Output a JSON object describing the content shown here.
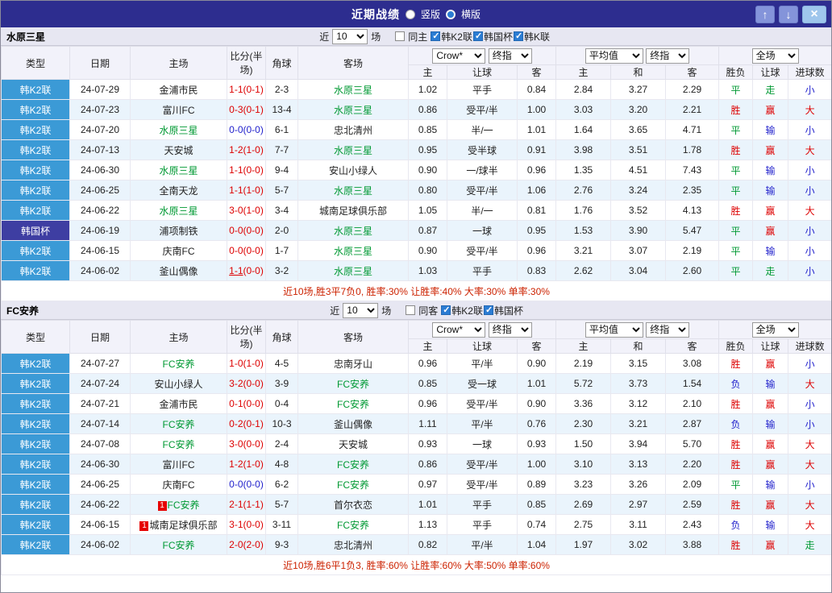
{
  "topbar": {
    "title": "近期战绩",
    "radio_vertical": "竖版",
    "radio_horizontal": "横版",
    "vertical_selected": false,
    "horizontal_selected": true,
    "up_icon": "↑",
    "down_icon": "↓",
    "close_icon": "×"
  },
  "colors": {
    "topbar_bg": "#2d2d8f",
    "league_blue": "#3b9ad6",
    "cup_purple": "#3e3ea2",
    "win_red": "#dd0000",
    "lose_blue": "#2222cc",
    "draw_green": "#009933",
    "team_green": "#009933",
    "row_alt": "#eaf4fc"
  },
  "columns": {
    "type": "类型",
    "date": "日期",
    "home": "主场",
    "score": "比分(半场)",
    "corner": "角球",
    "away": "客场",
    "h_home": "主",
    "h_hcp": "让球",
    "h_away": "客",
    "e_home": "主",
    "e_draw": "和",
    "e_away": "客",
    "r_result": "胜负",
    "r_hcp": "让球",
    "r_goals": "进球数"
  },
  "sections": [
    {
      "title": "水原三星",
      "controls": {
        "recent": "近",
        "matches": "场",
        "same": "同主",
        "same_checked": false,
        "filters": [
          {
            "label": "韩K2联",
            "on": true
          },
          {
            "label": "韩国杯",
            "on": true
          },
          {
            "label": "韩K联",
            "on": true
          }
        ]
      },
      "selects": {
        "count": "10",
        "source": "Crow*",
        "source_final": "终指",
        "avg": "平均值",
        "avg_final": "终指",
        "scope": "全场"
      },
      "rows": [
        {
          "league": "韩K2联",
          "league_class": "k2",
          "date": "24-07-29",
          "home": {
            "name": "金浦市民"
          },
          "score": {
            "main": "1-1",
            "half": "(0-1)",
            "color": "r"
          },
          "corner": "2-3",
          "away": {
            "name": "水原三星",
            "green": true
          },
          "handicap": [
            "1.02",
            "平手",
            "0.84"
          ],
          "europe": [
            "2.84",
            "3.27",
            "2.29"
          ],
          "results": [
            [
              "平",
              "g"
            ],
            [
              "走",
              "g"
            ],
            [
              "小",
              "b"
            ]
          ]
        },
        {
          "league": "韩K2联",
          "league_class": "k2",
          "date": "24-07-23",
          "home": {
            "name": "富川FC"
          },
          "score": {
            "main": "0-3",
            "half": "(0-1)",
            "color": "r"
          },
          "corner": "13-4",
          "away": {
            "name": "水原三星",
            "green": true
          },
          "handicap": [
            "0.86",
            "受平/半",
            "1.00"
          ],
          "europe": [
            "3.03",
            "3.20",
            "2.21"
          ],
          "results": [
            [
              "胜",
              "r"
            ],
            [
              "赢",
              "r"
            ],
            [
              "大",
              "r"
            ]
          ]
        },
        {
          "league": "韩K2联",
          "league_class": "k2",
          "date": "24-07-20",
          "home": {
            "name": "水原三星",
            "green": true
          },
          "score": {
            "main": "0-0",
            "half": "(0-0)",
            "color": "b"
          },
          "corner": "6-1",
          "away": {
            "name": "忠北清州"
          },
          "handicap": [
            "0.85",
            "半/一",
            "1.01"
          ],
          "europe": [
            "1.64",
            "3.65",
            "4.71"
          ],
          "results": [
            [
              "平",
              "g"
            ],
            [
              "输",
              "b"
            ],
            [
              "小",
              "b"
            ]
          ]
        },
        {
          "league": "韩K2联",
          "league_class": "k2",
          "date": "24-07-13",
          "home": {
            "name": "天安城"
          },
          "score": {
            "main": "1-2",
            "half": "(1-0)",
            "color": "r"
          },
          "corner": "7-7",
          "away": {
            "name": "水原三星",
            "green": true
          },
          "handicap": [
            "0.95",
            "受半球",
            "0.91"
          ],
          "europe": [
            "3.98",
            "3.51",
            "1.78"
          ],
          "results": [
            [
              "胜",
              "r"
            ],
            [
              "赢",
              "r"
            ],
            [
              "大",
              "r"
            ]
          ]
        },
        {
          "league": "韩K2联",
          "league_class": "k2",
          "date": "24-06-30",
          "home": {
            "name": "水原三星",
            "green": true
          },
          "score": {
            "main": "1-1",
            "half": "(0-0)",
            "color": "r"
          },
          "corner": "9-4",
          "away": {
            "name": "安山小绿人"
          },
          "handicap": [
            "0.90",
            "一/球半",
            "0.96"
          ],
          "europe": [
            "1.35",
            "4.51",
            "7.43"
          ],
          "results": [
            [
              "平",
              "g"
            ],
            [
              "输",
              "b"
            ],
            [
              "小",
              "b"
            ]
          ]
        },
        {
          "league": "韩K2联",
          "league_class": "k2",
          "date": "24-06-25",
          "home": {
            "name": "全南天龙"
          },
          "score": {
            "main": "1-1",
            "half": "(1-0)",
            "color": "r"
          },
          "corner": "5-7",
          "away": {
            "name": "水原三星",
            "green": true
          },
          "handicap": [
            "0.80",
            "受平/半",
            "1.06"
          ],
          "europe": [
            "2.76",
            "3.24",
            "2.35"
          ],
          "results": [
            [
              "平",
              "g"
            ],
            [
              "输",
              "b"
            ],
            [
              "小",
              "b"
            ]
          ]
        },
        {
          "league": "韩K2联",
          "league_class": "k2",
          "date": "24-06-22",
          "home": {
            "name": "水原三星",
            "green": true
          },
          "score": {
            "main": "3-0",
            "half": "(1-0)",
            "color": "r"
          },
          "corner": "3-4",
          "away": {
            "name": "城南足球俱乐部"
          },
          "handicap": [
            "1.05",
            "半/一",
            "0.81"
          ],
          "europe": [
            "1.76",
            "3.52",
            "4.13"
          ],
          "results": [
            [
              "胜",
              "r"
            ],
            [
              "赢",
              "r"
            ],
            [
              "大",
              "r"
            ]
          ]
        },
        {
          "league": "韩国杯",
          "league_class": "cup",
          "date": "24-06-19",
          "home": {
            "name": "浦项制铁"
          },
          "score": {
            "main": "0-0",
            "half": "(0-0)",
            "color": "r"
          },
          "corner": "2-0",
          "away": {
            "name": "水原三星",
            "green": true
          },
          "handicap": [
            "0.87",
            "一球",
            "0.95"
          ],
          "europe": [
            "1.53",
            "3.90",
            "5.47"
          ],
          "results": [
            [
              "平",
              "g"
            ],
            [
              "赢",
              "r"
            ],
            [
              "小",
              "b"
            ]
          ]
        },
        {
          "league": "韩K2联",
          "league_class": "k2",
          "date": "24-06-15",
          "home": {
            "name": "庆南FC"
          },
          "score": {
            "main": "0-0",
            "half": "(0-0)",
            "color": "r"
          },
          "corner": "1-7",
          "away": {
            "name": "水原三星",
            "green": true
          },
          "handicap": [
            "0.90",
            "受平/半",
            "0.96"
          ],
          "europe": [
            "3.21",
            "3.07",
            "2.19"
          ],
          "results": [
            [
              "平",
              "g"
            ],
            [
              "输",
              "b"
            ],
            [
              "小",
              "b"
            ]
          ]
        },
        {
          "league": "韩K2联",
          "league_class": "k2",
          "date": "24-06-02",
          "home": {
            "name": "釜山偶像"
          },
          "score": {
            "main": "1-1",
            "half": "(0-0)",
            "color": "r",
            "underline": true
          },
          "corner": "3-2",
          "away": {
            "name": "水原三星",
            "green": true
          },
          "handicap": [
            "1.03",
            "平手",
            "0.83"
          ],
          "europe": [
            "2.62",
            "3.04",
            "2.60"
          ],
          "results": [
            [
              "平",
              "g"
            ],
            [
              "走",
              "g"
            ],
            [
              "小",
              "b"
            ]
          ]
        }
      ],
      "summary": "近10场,胜3平7负0, 胜率:30% 让胜率:40% 大率:30% 单率:30%"
    },
    {
      "title": "FC安养",
      "controls": {
        "recent": "近",
        "matches": "场",
        "same": "同客",
        "same_checked": false,
        "filters": [
          {
            "label": "韩K2联",
            "on": true
          },
          {
            "label": "韩国杯",
            "on": true
          }
        ]
      },
      "selects": {
        "count": "10",
        "source": "Crow*",
        "source_final": "终指",
        "avg": "平均值",
        "avg_final": "终指",
        "scope": "全场"
      },
      "rows": [
        {
          "league": "韩K2联",
          "league_class": "k2",
          "date": "24-07-27",
          "home": {
            "name": "FC安养",
            "green": true
          },
          "score": {
            "main": "1-0",
            "half": "(1-0)",
            "color": "r"
          },
          "corner": "4-5",
          "away": {
            "name": "忠南牙山"
          },
          "handicap": [
            "0.96",
            "平/半",
            "0.90"
          ],
          "europe": [
            "2.19",
            "3.15",
            "3.08"
          ],
          "results": [
            [
              "胜",
              "r"
            ],
            [
              "赢",
              "r"
            ],
            [
              "小",
              "b"
            ]
          ]
        },
        {
          "league": "韩K2联",
          "league_class": "k2",
          "date": "24-07-24",
          "home": {
            "name": "安山小绿人"
          },
          "score": {
            "main": "3-2",
            "half": "(0-0)",
            "color": "r"
          },
          "corner": "3-9",
          "away": {
            "name": "FC安养",
            "green": true
          },
          "handicap": [
            "0.85",
            "受一球",
            "1.01"
          ],
          "europe": [
            "5.72",
            "3.73",
            "1.54"
          ],
          "results": [
            [
              "负",
              "b"
            ],
            [
              "输",
              "b"
            ],
            [
              "大",
              "r"
            ]
          ]
        },
        {
          "league": "韩K2联",
          "league_class": "k2",
          "date": "24-07-21",
          "home": {
            "name": "金浦市民"
          },
          "score": {
            "main": "0-1",
            "half": "(0-0)",
            "color": "r"
          },
          "corner": "0-4",
          "away": {
            "name": "FC安养",
            "green": true
          },
          "handicap": [
            "0.96",
            "受平/半",
            "0.90"
          ],
          "europe": [
            "3.36",
            "3.12",
            "2.10"
          ],
          "results": [
            [
              "胜",
              "r"
            ],
            [
              "赢",
              "r"
            ],
            [
              "小",
              "b"
            ]
          ]
        },
        {
          "league": "韩K2联",
          "league_class": "k2",
          "date": "24-07-14",
          "home": {
            "name": "FC安养",
            "green": true
          },
          "score": {
            "main": "0-2",
            "half": "(0-1)",
            "color": "r"
          },
          "corner": "10-3",
          "away": {
            "name": "釜山偶像"
          },
          "handicap": [
            "1.11",
            "平/半",
            "0.76"
          ],
          "europe": [
            "2.30",
            "3.21",
            "2.87"
          ],
          "results": [
            [
              "负",
              "b"
            ],
            [
              "输",
              "b"
            ],
            [
              "小",
              "b"
            ]
          ]
        },
        {
          "league": "韩K2联",
          "league_class": "k2",
          "date": "24-07-08",
          "home": {
            "name": "FC安养",
            "green": true
          },
          "score": {
            "main": "3-0",
            "half": "(0-0)",
            "color": "r"
          },
          "corner": "2-4",
          "away": {
            "name": "天安城"
          },
          "handicap": [
            "0.93",
            "一球",
            "0.93"
          ],
          "europe": [
            "1.50",
            "3.94",
            "5.70"
          ],
          "results": [
            [
              "胜",
              "r"
            ],
            [
              "赢",
              "r"
            ],
            [
              "大",
              "r"
            ]
          ]
        },
        {
          "league": "韩K2联",
          "league_class": "k2",
          "date": "24-06-30",
          "home": {
            "name": "富川FC"
          },
          "score": {
            "main": "1-2",
            "half": "(1-0)",
            "color": "r"
          },
          "corner": "4-8",
          "away": {
            "name": "FC安养",
            "green": true
          },
          "handicap": [
            "0.86",
            "受平/半",
            "1.00"
          ],
          "europe": [
            "3.10",
            "3.13",
            "2.20"
          ],
          "results": [
            [
              "胜",
              "r"
            ],
            [
              "赢",
              "r"
            ],
            [
              "大",
              "r"
            ]
          ]
        },
        {
          "league": "韩K2联",
          "league_class": "k2",
          "date": "24-06-25",
          "home": {
            "name": "庆南FC"
          },
          "score": {
            "main": "0-0",
            "half": "(0-0)",
            "color": "b"
          },
          "corner": "6-2",
          "away": {
            "name": "FC安养",
            "green": true
          },
          "handicap": [
            "0.97",
            "受平/半",
            "0.89"
          ],
          "europe": [
            "3.23",
            "3.26",
            "2.09"
          ],
          "results": [
            [
              "平",
              "g"
            ],
            [
              "输",
              "b"
            ],
            [
              "小",
              "b"
            ]
          ]
        },
        {
          "league": "韩K2联",
          "league_class": "k2",
          "date": "24-06-22",
          "home": {
            "name": "FC安养",
            "green": true,
            "badge": "1"
          },
          "score": {
            "main": "2-1",
            "half": "(1-1)",
            "color": "r"
          },
          "corner": "5-7",
          "away": {
            "name": "首尔衣恋"
          },
          "handicap": [
            "1.01",
            "平手",
            "0.85"
          ],
          "europe": [
            "2.69",
            "2.97",
            "2.59"
          ],
          "results": [
            [
              "胜",
              "r"
            ],
            [
              "赢",
              "r"
            ],
            [
              "大",
              "r"
            ]
          ]
        },
        {
          "league": "韩K2联",
          "league_class": "k2",
          "date": "24-06-15",
          "home": {
            "name": "城南足球俱乐部",
            "badge": "1"
          },
          "score": {
            "main": "3-1",
            "half": "(0-0)",
            "color": "r"
          },
          "corner": "3-11",
          "away": {
            "name": "FC安养",
            "green": true
          },
          "handicap": [
            "1.13",
            "平手",
            "0.74"
          ],
          "europe": [
            "2.75",
            "3.11",
            "2.43"
          ],
          "results": [
            [
              "负",
              "b"
            ],
            [
              "输",
              "b"
            ],
            [
              "大",
              "r"
            ]
          ]
        },
        {
          "league": "韩K2联",
          "league_class": "k2",
          "date": "24-06-02",
          "home": {
            "name": "FC安养",
            "green": true
          },
          "score": {
            "main": "2-0",
            "half": "(2-0)",
            "color": "r"
          },
          "corner": "9-3",
          "away": {
            "name": "忠北清州"
          },
          "handicap": [
            "0.82",
            "平/半",
            "1.04"
          ],
          "europe": [
            "1.97",
            "3.02",
            "3.88"
          ],
          "results": [
            [
              "胜",
              "r"
            ],
            [
              "赢",
              "r"
            ],
            [
              "走",
              "g"
            ]
          ]
        }
      ],
      "summary": "近10场,胜6平1负3, 胜率:60% 让胜率:60% 大率:50% 单率:60%"
    }
  ]
}
